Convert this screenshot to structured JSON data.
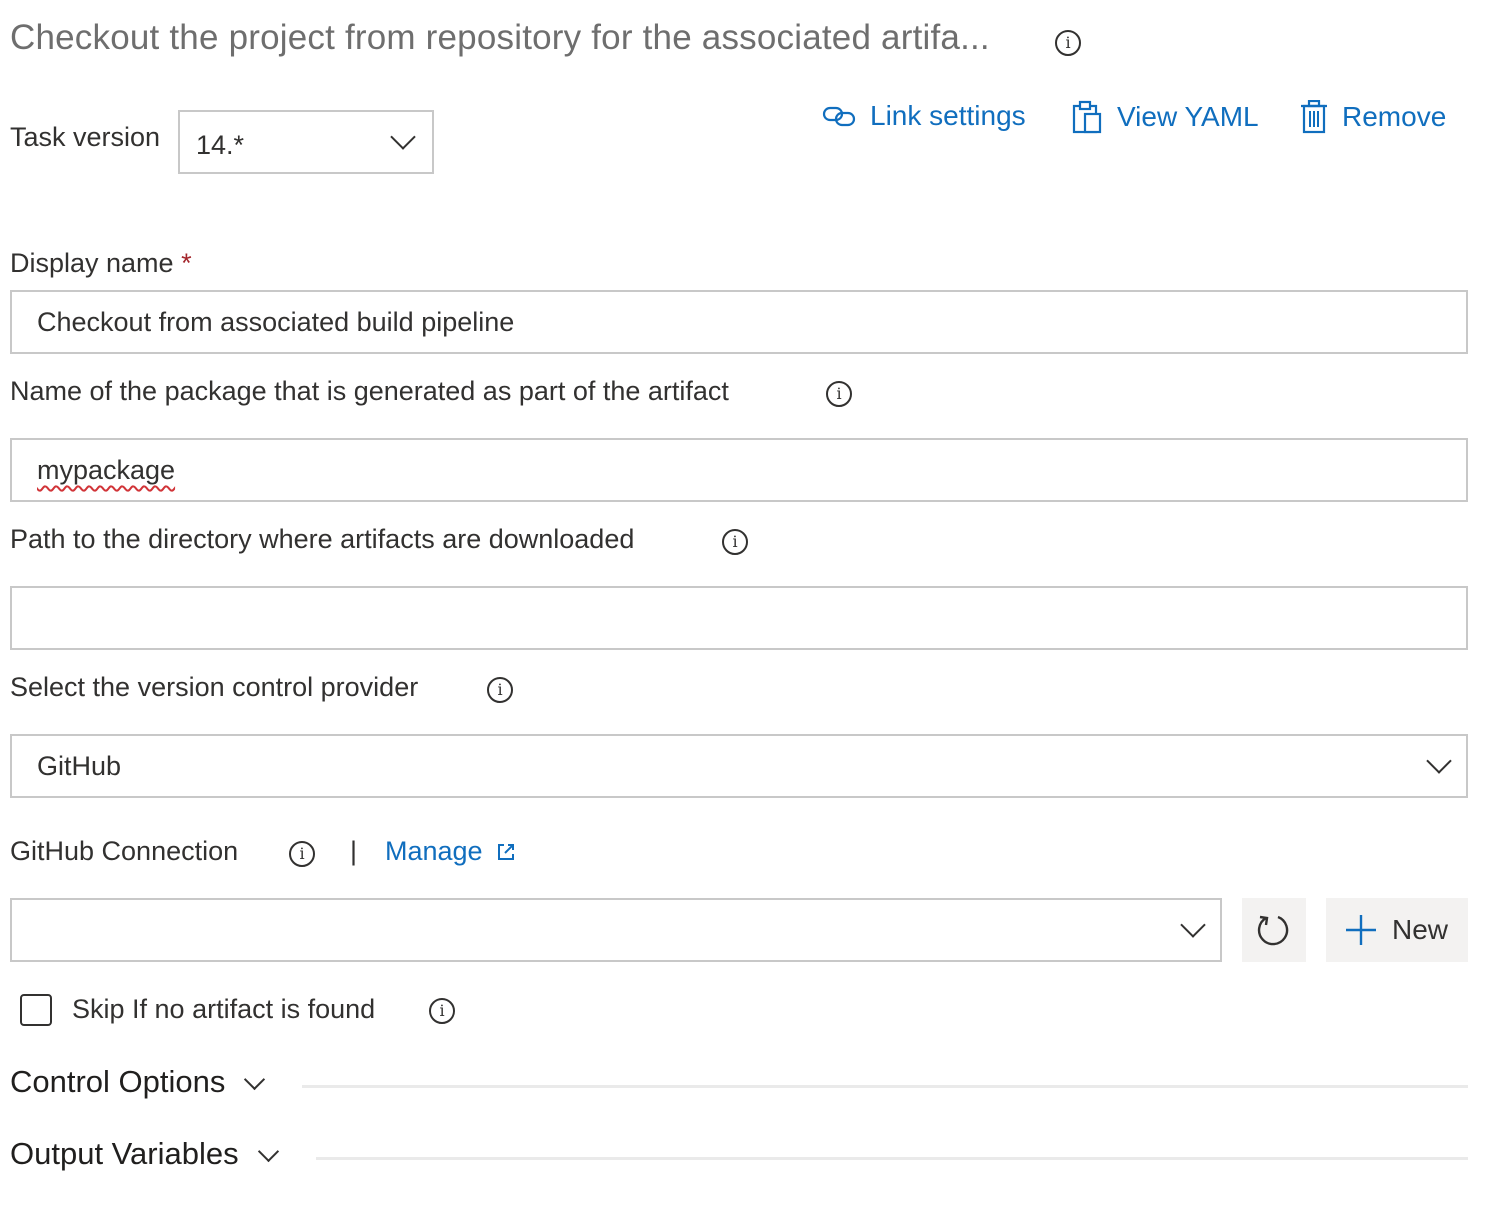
{
  "header": {
    "title": "Checkout the project from repository for the associated artifa...",
    "title_info_icon": "info-icon"
  },
  "toolbar": {
    "link_settings": "Link settings",
    "view_yaml": "View YAML",
    "remove": "Remove",
    "link_icon": "link-icon",
    "clipboard_icon": "clipboard-icon",
    "trash_icon": "trash-icon"
  },
  "task_version": {
    "label": "Task version",
    "value": "14.*"
  },
  "display_name": {
    "label": "Display name",
    "required_mark": "*",
    "value": "Checkout  from associated build pipeline"
  },
  "package_name": {
    "label": "Name of the package that is generated as part of the artifact",
    "value": "mypackage"
  },
  "download_path": {
    "label": "Path to the directory where artifacts are downloaded",
    "value": ""
  },
  "vcs_provider": {
    "label": "Select the version control provider",
    "value": "GitHub"
  },
  "github_connection": {
    "label": "GitHub Connection",
    "separator": "|",
    "manage": "Manage",
    "value": "",
    "new_button": "New"
  },
  "skip_checkbox": {
    "label": "Skip If no artifact is found",
    "checked": false
  },
  "sections": {
    "control_options": "Control Options",
    "output_variables": "Output Variables"
  },
  "colors": {
    "link": "#106ebe",
    "required": "#a4262c",
    "border": "#c8c8c8"
  }
}
